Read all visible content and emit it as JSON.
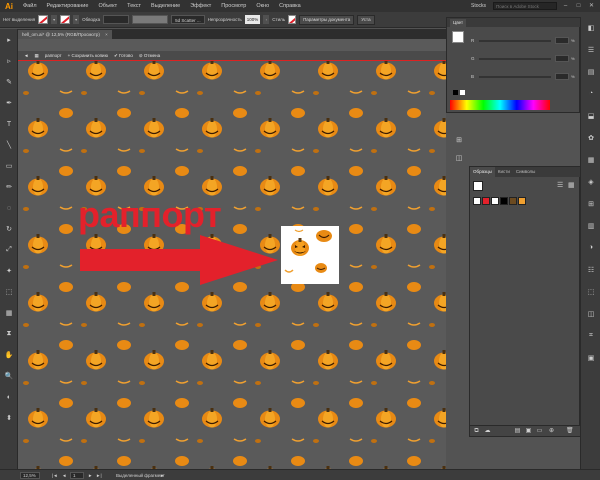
{
  "app": {
    "logo": "Ai"
  },
  "menu": {
    "items": [
      "Файл",
      "Редактирование",
      "Объект",
      "Текст",
      "Выделение",
      "Эффект",
      "Просмотр",
      "Окно",
      "Справка"
    ],
    "stocks_label": "Stocks",
    "search_placeholder": "Поиск в Adobe Stock"
  },
  "control_bar": {
    "no_selection": "Нет выделения",
    "stroke_label": "Обводка",
    "brush_name": "5d Scatter ...",
    "opacity_label": "Непрозрачность",
    "opacity_value": "100%",
    "style_label": "Стиль",
    "doc_settings": "Параметры документа",
    "prefs_partial": "Уста"
  },
  "document": {
    "tab_title": "hell_om.ai* @ 12,5% (RGB/Просмотр)",
    "close": "×"
  },
  "pattern_mode": {
    "name": "раппорт",
    "save_copy": "Сохранить копию",
    "done": "Готово",
    "cancel": "Отмена"
  },
  "canvas": {
    "overlay_text": "раппорт"
  },
  "color_panel": {
    "title": "Цвет",
    "channels": [
      "R",
      "G",
      "B"
    ],
    "pct": "%"
  },
  "swatches_panel": {
    "tabs": [
      "Образцы",
      "Кисти",
      "Символы"
    ]
  },
  "status": {
    "zoom": "12,5%",
    "page": "1",
    "selection_label": "Выделенный фрагмент"
  },
  "colors": {
    "accent_red": "#e3212b",
    "pumpkin": "#e88a14",
    "canvas_bg": "#5a5a5a",
    "panel_bg": "#4a4a4a"
  }
}
